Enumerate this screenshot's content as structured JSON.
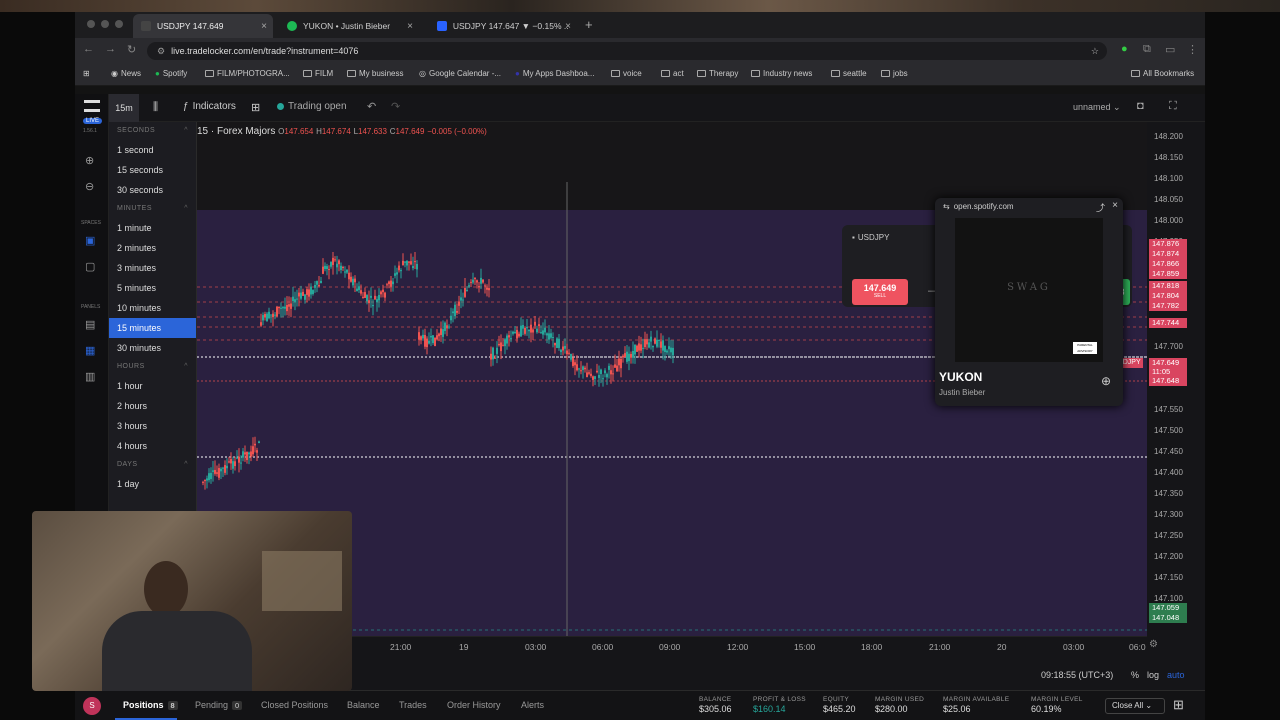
{
  "browser": {
    "tabs": [
      {
        "label": "USDJPY 147.649"
      },
      {
        "label": "YUKON • Justin Bieber"
      },
      {
        "label": "USDJPY 147.647 ▼ −0.15% ..."
      }
    ],
    "url": "live.tradelocker.com/en/trade?instrument=4076",
    "bookmarks": [
      "News",
      "Spotify",
      "FILM/PHOTOGRA...",
      "FILM",
      "My business",
      "Google Calendar -...",
      "My Apps Dashboa...",
      "voice",
      "act",
      "Therapy",
      "Industry news",
      "seattle",
      "jobs"
    ],
    "all_bookmarks": "All Bookmarks"
  },
  "app": {
    "live_badge": "LIVE",
    "version": "1.56.1",
    "spaces_label": "SPACES",
    "panels_label": "PANELS",
    "timeframe": "15m",
    "indicators_label": "Indicators",
    "trading_status": "Trading open",
    "layout_name": "unnamed",
    "instrument_header": "15 · Forex Majors",
    "ohlc": {
      "o_label": "O",
      "o": "147.654",
      "h_label": "H",
      "h": "147.674",
      "l_label": "L",
      "l": "147.633",
      "c_label": "C",
      "c": "147.649",
      "change": "−0.005 (−0.00%)"
    }
  },
  "timeframe_menu": {
    "sections": [
      {
        "title": "SECONDS",
        "items": [
          "1 second",
          "15 seconds",
          "30 seconds"
        ]
      },
      {
        "title": "MINUTES",
        "items": [
          "1 minute",
          "2 minutes",
          "3 minutes",
          "5 minutes",
          "10 minutes",
          "15 minutes",
          "30 minutes"
        ]
      },
      {
        "title": "HOURS",
        "items": [
          "1 hour",
          "2 hours",
          "3 hours",
          "4 hours"
        ]
      },
      {
        "title": "DAYS",
        "items": [
          "1 day"
        ]
      }
    ],
    "selected": "15 minutes"
  },
  "trade_widget": {
    "symbol": "USDJPY",
    "sell_price": "147.649",
    "sell_label": "SELL",
    "buy_price": "648"
  },
  "spotify_popup": {
    "host": "open.spotify.com",
    "album_text": "SWAG",
    "track": "YUKON",
    "artist": "Justin Bieber",
    "advisory": "PARENTAL ADVISORY"
  },
  "y_axis": {
    "labels": [
      "148.200",
      "148.150",
      "148.100",
      "148.050",
      "148.000",
      "147.950",
      "147.700",
      "147.550",
      "147.500",
      "147.450",
      "147.400",
      "147.350",
      "147.300",
      "147.250",
      "147.200",
      "147.150",
      "147.100"
    ],
    "tags": [
      "147.876",
      "147.874",
      "147.866",
      "147.859",
      "147.818",
      "147.804",
      "147.782",
      "147.744",
      "147.649",
      "11:05",
      "147.648",
      "147.059",
      "147.048"
    ],
    "symbol_tag": "USDJPY"
  },
  "x_axis": {
    "labels": [
      "21:00",
      "19",
      "03:00",
      "06:00",
      "09:00",
      "12:00",
      "15:00",
      "18:00",
      "21:00",
      "20",
      "03:00",
      "06:0"
    ]
  },
  "status": {
    "clock": "09:18:55 (UTC+3)",
    "pct": "%",
    "log": "log",
    "auto": "auto"
  },
  "bottom": {
    "avatar": "S",
    "tabs": [
      {
        "label": "Positions",
        "count": "8"
      },
      {
        "label": "Pending",
        "count": "0"
      },
      {
        "label": "Closed Positions"
      },
      {
        "label": "Balance"
      },
      {
        "label": "Trades"
      },
      {
        "label": "Order History"
      },
      {
        "label": "Alerts"
      }
    ],
    "stats": [
      {
        "label": "BALANCE",
        "value": "$305.06"
      },
      {
        "label": "PROFIT & LOSS",
        "value": "$160.14"
      },
      {
        "label": "EQUITY",
        "value": "$465.20"
      },
      {
        "label": "MARGIN USED",
        "value": "$280.00"
      },
      {
        "label": "MARGIN AVAILABLE",
        "value": "$25.06"
      },
      {
        "label": "MARGIN LEVEL",
        "value": "60.19%"
      }
    ],
    "close_all": "Close All"
  },
  "colors": {
    "accent": "#2b65d9",
    "up": "#26a69a",
    "down": "#ef5350",
    "bg_purple": "#2a2040"
  }
}
